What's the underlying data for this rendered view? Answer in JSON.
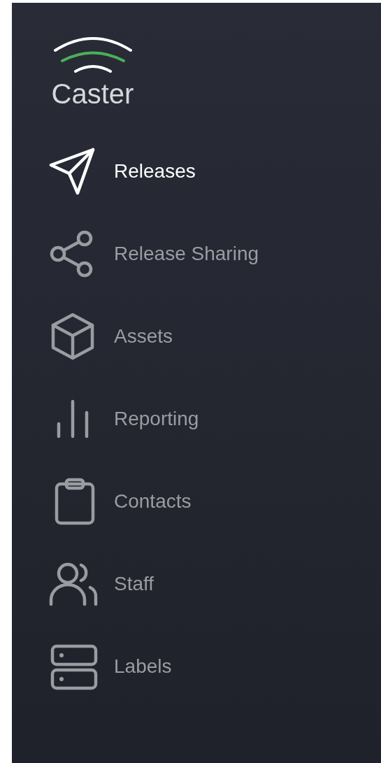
{
  "brand": {
    "name": "Caster"
  },
  "nav": [
    {
      "label": "Releases",
      "selected": true
    },
    {
      "label": "Release Sharing",
      "selected": false
    },
    {
      "label": "Assets",
      "selected": false
    },
    {
      "label": "Reporting",
      "selected": false
    },
    {
      "label": "Contacts",
      "selected": false
    },
    {
      "label": "Staff",
      "selected": false
    },
    {
      "label": "Labels",
      "selected": false
    }
  ]
}
